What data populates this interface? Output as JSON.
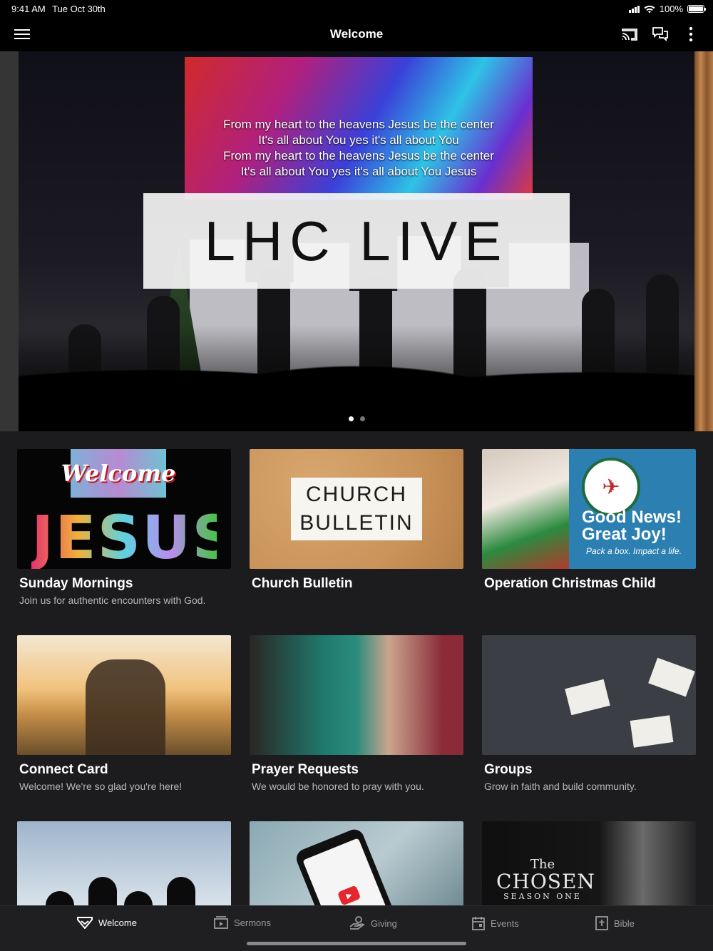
{
  "status": {
    "time": "9:41 AM",
    "date": "Tue Oct 30th",
    "battery": "100%"
  },
  "nav": {
    "title": "Welcome"
  },
  "hero": {
    "lyrics": [
      "From my heart to the heavens Jesus be the center",
      "It's all about You yes it's all about You",
      "From my heart to the heavens Jesus be the center",
      "It's all about You yes it's all about You Jesus"
    ],
    "banner": "LHC LIVE",
    "page_count": 2,
    "current_page": 1
  },
  "cards": [
    {
      "title": "Sunday Mornings",
      "subtitle": "Join us for authentic encounters with God.",
      "sign": "Welcome",
      "word": "JESUS"
    },
    {
      "title": "Church Bulletin",
      "subtitle": "",
      "line1": "CHURCH",
      "line2": "BULLETIN"
    },
    {
      "title": "Operation Christmas Child",
      "subtitle": "",
      "headline1": "Good News!",
      "headline2": "Great Joy!",
      "tagline": "Pack a box. Impact a life."
    },
    {
      "title": "Connect Card",
      "subtitle": "Welcome! We're so glad you're here!"
    },
    {
      "title": "Prayer Requests",
      "subtitle": "We would be honored to pray with you."
    },
    {
      "title": "Groups",
      "subtitle": "Grow in faith and build community."
    },
    {
      "title": "",
      "subtitle": ""
    },
    {
      "title": "",
      "subtitle": ""
    },
    {
      "title": "",
      "subtitle": "",
      "wm_a": "The",
      "wm_b": "CHOSEN",
      "wm_c": "SEASON ONE"
    }
  ],
  "tabs": [
    {
      "label": "Welcome",
      "icon": "welcome-icon",
      "active": true
    },
    {
      "label": "Sermons",
      "icon": "sermons-icon",
      "active": false
    },
    {
      "label": "Giving",
      "icon": "giving-icon",
      "active": false
    },
    {
      "label": "Events",
      "icon": "events-icon",
      "active": false
    },
    {
      "label": "Bible",
      "icon": "bible-icon",
      "active": false
    }
  ]
}
